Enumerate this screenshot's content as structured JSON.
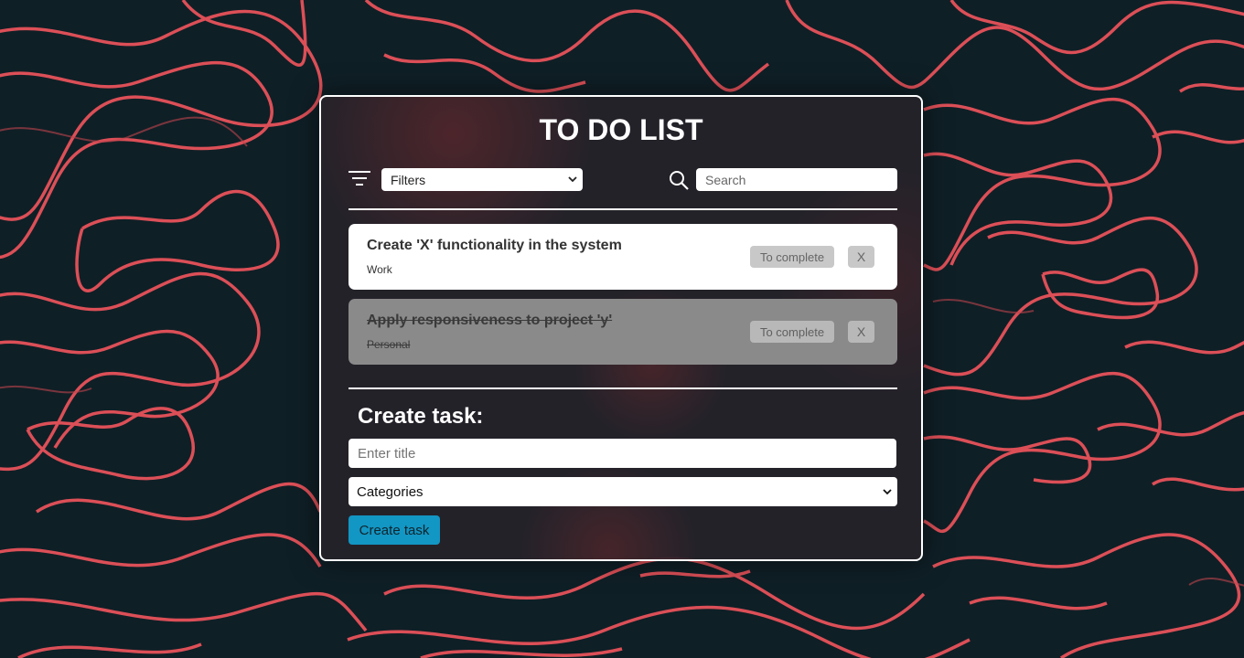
{
  "page": {
    "title": "TO DO LIST"
  },
  "toolbar": {
    "filter_select_value": "Filters",
    "search_placeholder": "Search"
  },
  "tasks": [
    {
      "title": "Create 'X' functionality in the system",
      "category": "Work",
      "completed": false,
      "complete_label": "To complete",
      "delete_label": "X"
    },
    {
      "title": "Apply responsiveness to project 'y'",
      "category": "Personal",
      "completed": true,
      "complete_label": "To complete",
      "delete_label": "X"
    }
  ],
  "create": {
    "heading": "Create task:",
    "title_placeholder": "Enter title",
    "category_select_value": "Categories",
    "button_label": "Create task"
  },
  "colors": {
    "background": "#0f1f26",
    "contour_lines": "#e8525a",
    "panel": "#26222a",
    "create_button": "#1296c4",
    "completed_task": "#8a8a8a"
  },
  "icons": {
    "filter": "filter-icon",
    "search": "search-icon",
    "select_chevron": "chevron-down-icon"
  }
}
